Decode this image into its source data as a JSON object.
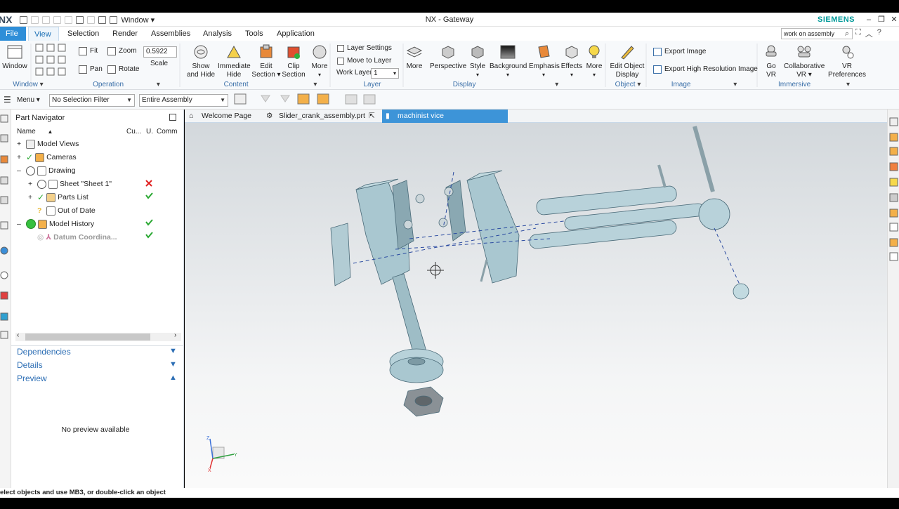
{
  "titlebar": {
    "logo": "NX",
    "window_menu": "Window ▾",
    "title": "NX - Gateway",
    "brand": "SIEMENS",
    "min": "–",
    "max": "❐",
    "close": "✕"
  },
  "menubar": {
    "tabs": [
      "File",
      "View",
      "Selection",
      "Render",
      "Assemblies",
      "Analysis",
      "Tools",
      "Application"
    ],
    "search_value": "work on assembly"
  },
  "ribbon": {
    "window": {
      "label": "Window",
      "group": "Window"
    },
    "operation": {
      "fit": "Fit",
      "zoom": "Zoom",
      "pan": "Pan",
      "rotate": "Rotate",
      "scale_value": "0.5922",
      "scale_label": "Scale",
      "group": "Operation"
    },
    "content": {
      "show_hide": [
        "Show",
        "and Hide"
      ],
      "immediate_hide": [
        "Immediate",
        "Hide"
      ],
      "edit_section": [
        "Edit",
        "Section ▾"
      ],
      "clip_section": [
        "Clip",
        "Section"
      ],
      "more": "More",
      "group": "Content"
    },
    "layer": {
      "settings": "Layer Settings",
      "move": "Move to Layer",
      "work_layer": "Work Layer",
      "work_layer_value": "1",
      "group": "Layer"
    },
    "display": {
      "more1": "More",
      "perspective": "Perspective",
      "style": "Style",
      "background": "Background",
      "emphasis": "Emphasis",
      "effects": "Effects",
      "more2": "More",
      "group": "Display"
    },
    "object": {
      "edit": [
        "Edit Object",
        "Display"
      ],
      "group": "Object"
    },
    "image": {
      "export": "Export Image",
      "export_hr": "Export High Resolution Image",
      "group": "Image"
    },
    "immersive": {
      "go": [
        "Go",
        "VR"
      ],
      "collab": [
        "Collaborative",
        "VR ▾"
      ],
      "prefs": [
        "VR",
        "Preferences"
      ],
      "group": "Immersive"
    }
  },
  "toolbar2": {
    "menu": "Menu ▾",
    "selection_filter": "No Selection Filter",
    "scope": "Entire Assembly"
  },
  "navigator": {
    "title": "Part Navigator",
    "columns": [
      "Name",
      "Cu...",
      "U.",
      "Comm"
    ],
    "rows": [
      {
        "label": "Model Views",
        "exp": "+"
      },
      {
        "label": "Cameras",
        "exp": "+"
      },
      {
        "label": "Drawing",
        "exp": "–"
      },
      {
        "label": "Sheet \"Sheet 1\"",
        "exp": "+"
      },
      {
        "label": "Parts List",
        "exp": "+"
      },
      {
        "label": "Out of Date",
        "exp": ""
      },
      {
        "label": "Model History",
        "exp": "–"
      },
      {
        "label": "Datum Coordina...",
        "exp": ""
      }
    ],
    "sections": {
      "dependencies": "Dependencies",
      "details": "Details",
      "preview": "Preview"
    },
    "preview_text": "No preview available"
  },
  "view_tabs": [
    "Welcome Page",
    "Slider_crank_assembly.prt",
    "machinist vice assembly.prt"
  ],
  "status": "elect objects and use MB3, or double-click an object",
  "colors": {
    "accent": "#2e8ed8",
    "brand": "#009999",
    "check": "#2aa832",
    "error": "#e02020"
  }
}
